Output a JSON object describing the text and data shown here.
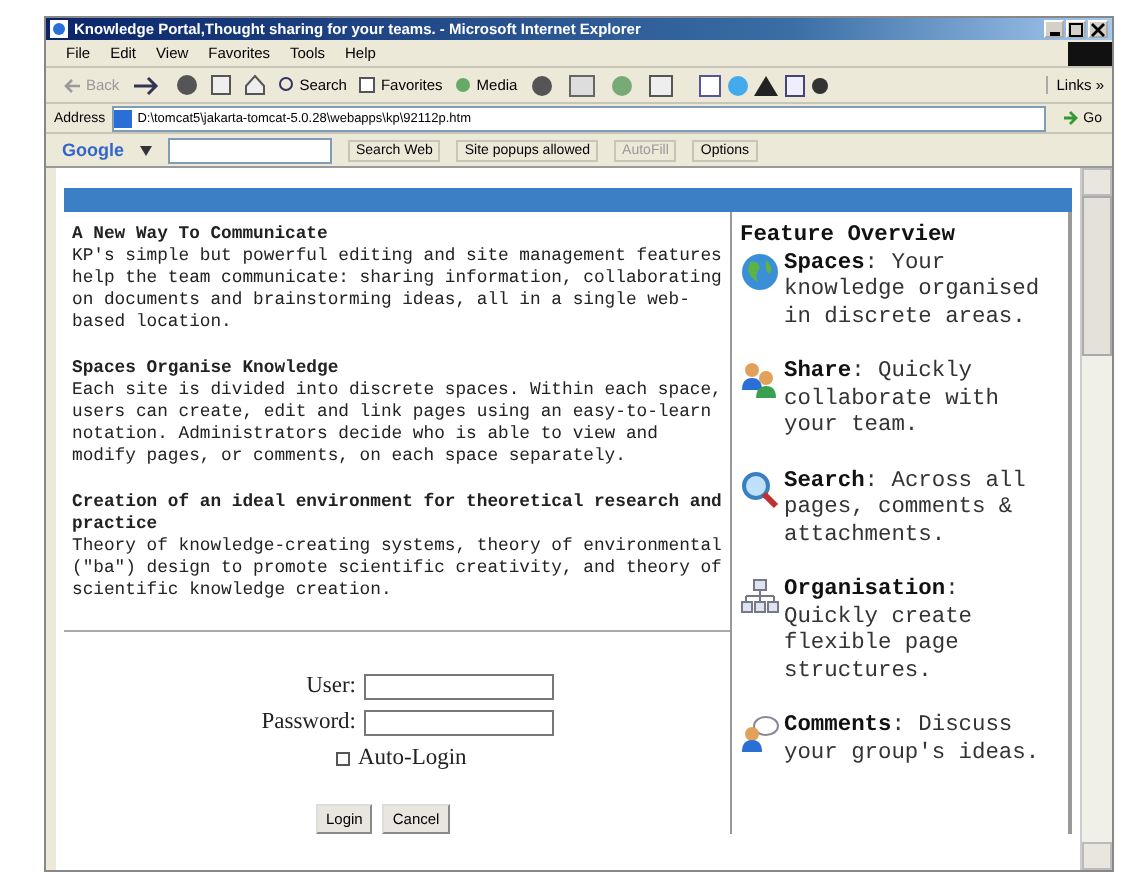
{
  "window": {
    "title": "Knowledge Portal,Thought sharing for your teams. - Microsoft Internet Explorer"
  },
  "menu": [
    "File",
    "Edit",
    "View",
    "Favorites",
    "Tools",
    "Help"
  ],
  "toolbar": {
    "back": "Back",
    "search": "Search",
    "favorites": "Favorites",
    "media": "Media",
    "links": "Links »"
  },
  "address": {
    "label": "Address",
    "url": "D:\\tomcat5\\jakarta-tomcat-5.0.28\\webapps\\kp\\92112p.htm",
    "go": "Go"
  },
  "google_bar": {
    "logo": "Google",
    "search_web": "Search Web",
    "popups": "Site popups allowed",
    "autofill": "AutoFill",
    "options": "Options"
  },
  "sections": [
    {
      "heading": "A New Way To Communicate",
      "body": "KP's simple but powerful editing and site management features help the team communicate: sharing information, collaborating on documents and brainstorming ideas, all in a single web-based location."
    },
    {
      "heading": "Spaces Organise Knowledge",
      "body": "Each site is divided into discrete spaces. Within each space, users can create, edit and link pages using an easy-to-learn notation. Administrators decide who is able to view and modify pages, or comments, on each space separately."
    },
    {
      "heading": "Creation of an ideal environment for theoretical research and practice",
      "body": "Theory of knowledge-creating systems, theory of environmental (\"ba\") design to promote scientific creativity, and theory of scientific knowledge creation."
    }
  ],
  "login": {
    "user_label": "User:",
    "password_label": "Password:",
    "auto_login": {
      "label": "Auto-Login",
      "checked": false
    },
    "buttons": [
      "Login",
      "Cancel"
    ]
  },
  "feature_overview": {
    "title": "Feature Overview",
    "features": [
      {
        "kind": "globe",
        "text": "**Spaces**: Your knowledge organised in discrete areas."
      },
      {
        "kind": "people",
        "text": "**Share**: Quickly collaborate with your team."
      },
      {
        "kind": "magnifier",
        "text": "**Search**: Across all pages, comments & attachments."
      },
      {
        "kind": "tree",
        "text": "**Organisation**: Quickly create flexible page structures."
      },
      {
        "kind": "comment",
        "text": "**Comments**: Discuss your group's ideas."
      }
    ]
  }
}
